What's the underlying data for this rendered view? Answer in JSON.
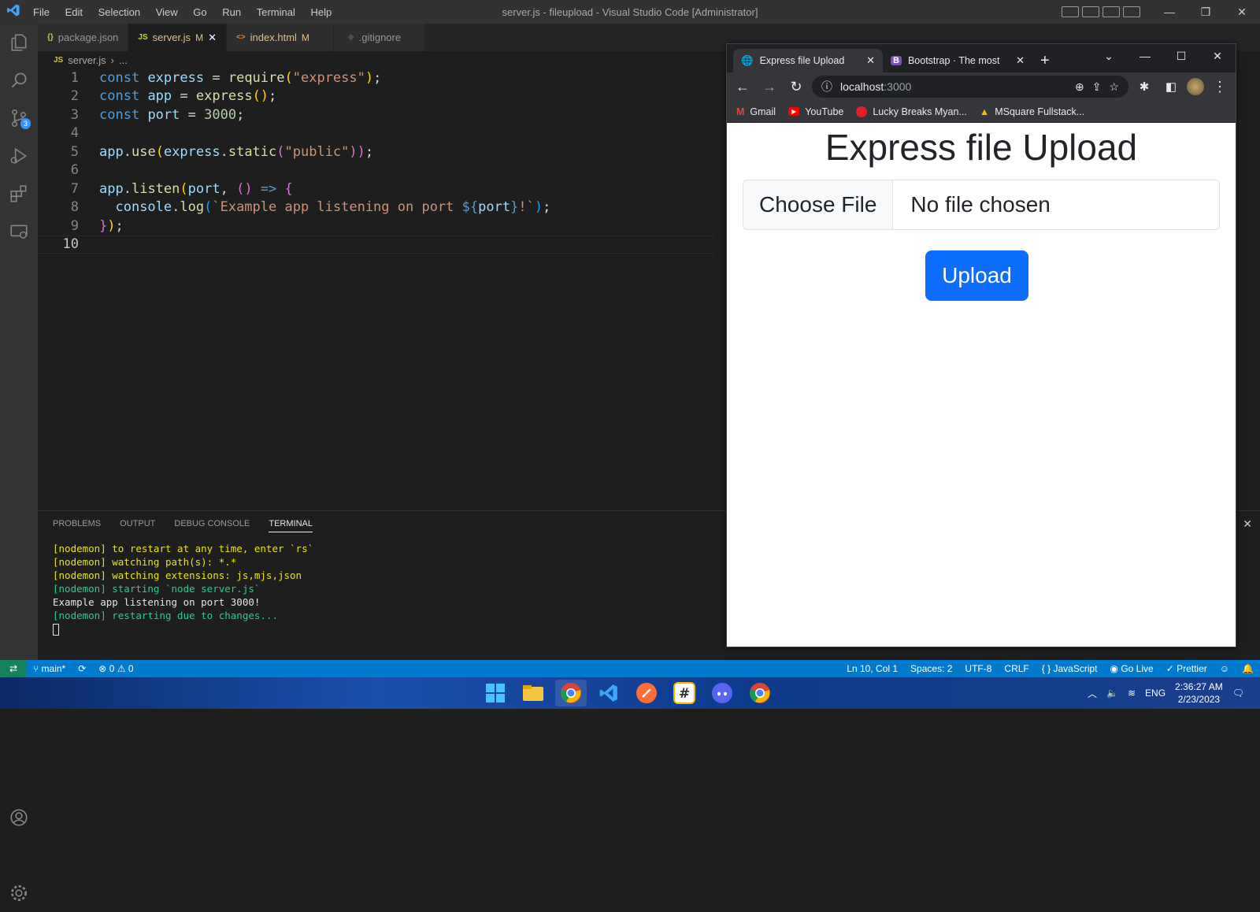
{
  "vscode": {
    "window_title": "server.js - fileupload - Visual Studio Code [Administrator]",
    "menu": [
      "File",
      "Edit",
      "Selection",
      "View",
      "Go",
      "Run",
      "Terminal",
      "Help"
    ],
    "scm_badge": "3",
    "tabs": [
      {
        "icon": "{}",
        "label": "package.json",
        "modified": ""
      },
      {
        "icon": "JS",
        "label": "server.js",
        "modified": "M"
      },
      {
        "icon": "<>",
        "label": "index.html",
        "modified": "M"
      },
      {
        "icon": "◆",
        "label": ".gitignore",
        "modified": ""
      }
    ],
    "breadcrumb": {
      "icon": "JS",
      "file": "server.js",
      "rest": "..."
    },
    "code_lines": [
      "1",
      "2",
      "3",
      "4",
      "5",
      "6",
      "7",
      "8",
      "9",
      "10"
    ],
    "code": {
      "l1": [
        "const",
        "express",
        "=",
        "require",
        "(",
        "\"express\"",
        ")",
        ";"
      ],
      "l2": [
        "const",
        "app",
        "=",
        "express",
        "()",
        ";"
      ],
      "l3": [
        "const",
        "port",
        "=",
        "3000",
        ";"
      ],
      "l5": [
        "app",
        ".",
        "use",
        "(",
        "express",
        ".",
        "static",
        "(",
        "\"public\"",
        "))",
        ";"
      ],
      "l7": [
        "app",
        ".",
        "listen",
        "(",
        "port",
        ", ",
        "()",
        " => ",
        "{"
      ],
      "l8": [
        "console",
        ".",
        "log",
        "(",
        "`Example app listening on port ",
        "${",
        "port",
        "}",
        "!`",
        ")",
        ";"
      ],
      "l9": [
        "}",
        ")",
        ";"
      ]
    },
    "panel_tabs": [
      "PROBLEMS",
      "OUTPUT",
      "DEBUG CONSOLE",
      "TERMINAL"
    ],
    "terminal": [
      "[nodemon] to restart at any time, enter `rs`",
      "[nodemon] watching path(s): *.*",
      "[nodemon] watching extensions: js,mjs,json",
      "[nodemon] starting `node server.js`",
      "Example app listening on port 3000!",
      "[nodemon] restarting due to changes..."
    ],
    "status": {
      "branch": "main*",
      "errors": "0",
      "warnings": "0",
      "position": "Ln 10, Col 1",
      "spaces": "Spaces: 2",
      "encoding": "UTF-8",
      "eol": "CRLF",
      "language": "JavaScript",
      "golive": "Go Live",
      "prettier": "Prettier"
    }
  },
  "browser": {
    "tabs": [
      {
        "label": "Express file Upload"
      },
      {
        "label": "Bootstrap · The most p"
      }
    ],
    "url_host": "localhost",
    "url_port": ":3000",
    "bookmarks": [
      "Gmail",
      "YouTube",
      "Lucky Breaks Myan...",
      "MSquare Fullstack..."
    ],
    "page": {
      "heading": "Express file Upload",
      "choose_file": "Choose File",
      "no_file": "No file chosen",
      "upload": "Upload"
    }
  },
  "taskbar": {
    "lang": "ENG",
    "time": "2:36:27 AM",
    "date": "2/23/2023"
  },
  "colors": {
    "accent": "#007acc",
    "bootstrap_primary": "#0d6efd",
    "remote": "#16825d"
  }
}
